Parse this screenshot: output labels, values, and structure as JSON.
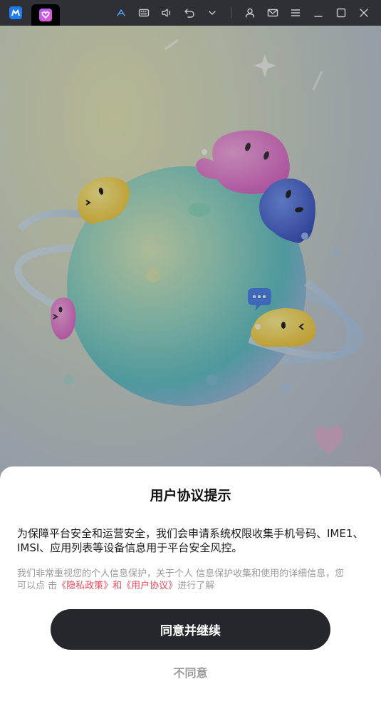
{
  "taskbar": {
    "tabs": [
      {
        "icon": "mumu-app-icon",
        "active": false
      },
      {
        "icon": "purple-heart-app-icon",
        "active": true
      }
    ],
    "tools": [
      "gamepad-icon",
      "keyboard-icon",
      "volume-icon",
      "undo-icon",
      "chevron-down-icon",
      "user-icon",
      "mail-icon",
      "menu-icon",
      "minimize-icon",
      "maximize-icon",
      "close-icon"
    ]
  },
  "dialog": {
    "title": "用户协议提示",
    "body": "为保障平台安全和运营安全，我们会申请系统权限收集手机号码、IME1、IMSI、应用列表等设备信息用于平台安全风控。",
    "note_prefix": "我们非常重视您的个人信息保护，关于个人 信息保护收集和使用的详细信息，您可以点 击",
    "privacy_link": "《隐私政策》",
    "and_text": "和",
    "user_agreement_link": "《用户协议》",
    "note_suffix": "进行了解",
    "agree_label": "同意并继续",
    "disagree_label": "不同意"
  },
  "colors": {
    "accent_link": "#e8485a",
    "agree_button": "#25272c"
  }
}
